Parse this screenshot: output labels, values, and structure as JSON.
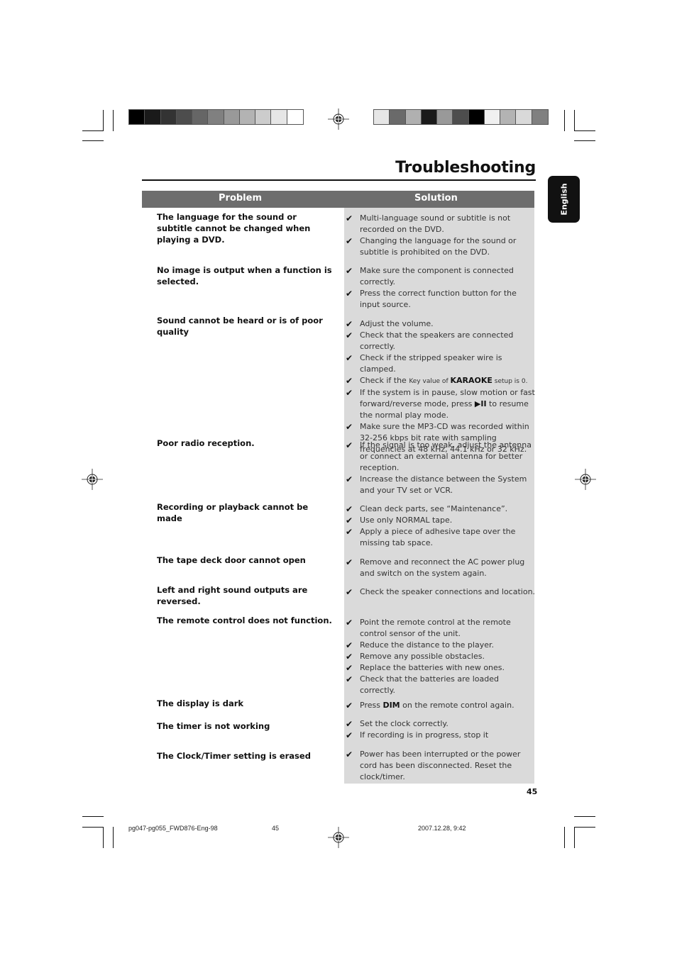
{
  "colors": {
    "header_bg": "#6d6d6d",
    "solution_bg": "#dadada",
    "tab_bg": "#111111",
    "left_swatches": [
      "#000000",
      "#1a1a1a",
      "#333333",
      "#4d4d4d",
      "#666666",
      "#808080",
      "#999999",
      "#b3b3b3",
      "#cccccc",
      "#e6e6e6",
      "#ffffff"
    ],
    "right_swatches": [
      "#e6e6e6",
      "#6a6a6a",
      "#b0b0b0",
      "#1a1a1a",
      "#999999",
      "#4d4d4d",
      "#000000",
      "#f0f0f0",
      "#b3b3b3",
      "#d9d9d9",
      "#808080"
    ]
  },
  "page": {
    "title": "Troubleshooting",
    "language_tab": "English",
    "page_number": "45"
  },
  "table": {
    "headers": {
      "problem": "Problem",
      "solution": "Solution"
    },
    "check_icon": "✔",
    "rows": [
      {
        "problem": "The language for the sound or subtitle cannot be changed when playing a DVD.",
        "solutions": [
          "Multi-language sound or subtitle is not recorded on the DVD.",
          "Changing the language for the sound or subtitle is prohibited on the DVD."
        ]
      },
      {
        "problem": "No image is output when a function is selected.",
        "solutions": [
          "Make sure the component is connected correctly.",
          "Press the correct function button for the input source."
        ]
      },
      {
        "problem": "Sound cannot be heard or is of poor quality",
        "solutions": [
          "Adjust the volume.",
          "Check that the speakers are connected correctly.",
          "Check if the stripped speaker wire is clamped.",
          {
            "pre": " Check if the ",
            "small1": "Key value of ",
            "kw": "KARAOKE",
            "small2": " setup is 0."
          },
          {
            "pre": "If the system is in pause, slow motion or fast forward/reverse mode, press ",
            "kw": "▶II",
            "post": " to resume the normal play mode."
          },
          "Make sure the MP3-CD was recorded within 32-256 kbps bit rate with sampling frequencies at 48 kHz, 44.1 kHz or 32 kHz."
        ]
      },
      {
        "problem": "Poor radio reception.",
        "solutions": [
          "If the signal is too weak, adjust the antenna or connect an external antenna for better reception.",
          "Increase the distance between the System and your TV set or VCR."
        ]
      },
      {
        "problem": "Recording or playback cannot be made",
        "solutions": [
          "Clean deck parts, see “Maintenance”.",
          "Use only NORMAL tape.",
          "Apply a piece of adhesive tape over the missing tab space."
        ]
      },
      {
        "problem": "The tape deck door cannot open",
        "solutions": [
          "Remove and reconnect the AC power plug and switch on the system again."
        ]
      },
      {
        "problem": "Left and right sound outputs are reversed.",
        "solutions": [
          "Check the speaker connections and location."
        ]
      },
      {
        "problem": "The remote control does not function.",
        "solutions": [
          "Point the remote control at the remote control sensor of the unit.",
          "Reduce the distance to the player.",
          "Remove any possible obstacles.",
          "Replace the batteries with new ones.",
          "Check that the batteries are loaded correctly."
        ]
      },
      {
        "problem": "The display is dark",
        "solutions": [
          {
            "pre": "Press ",
            "kw": "DIM",
            "kw2": " on the remote control",
            "post": " again."
          }
        ]
      },
      {
        "problem": "The timer is not working",
        "solutions": [
          "Set the clock correctly.",
          "If recording is in progress, stop it"
        ]
      },
      {
        "problem": "The Clock/Timer setting is erased",
        "solutions": [
          "Power has been interrupted or the power cord has been disconnected. Reset the clock/timer."
        ]
      }
    ]
  },
  "footer": {
    "file_name": "pg047-pg055_FWD876-Eng-98",
    "page": "45",
    "timestamp": "2007.12.28, 9:42"
  }
}
